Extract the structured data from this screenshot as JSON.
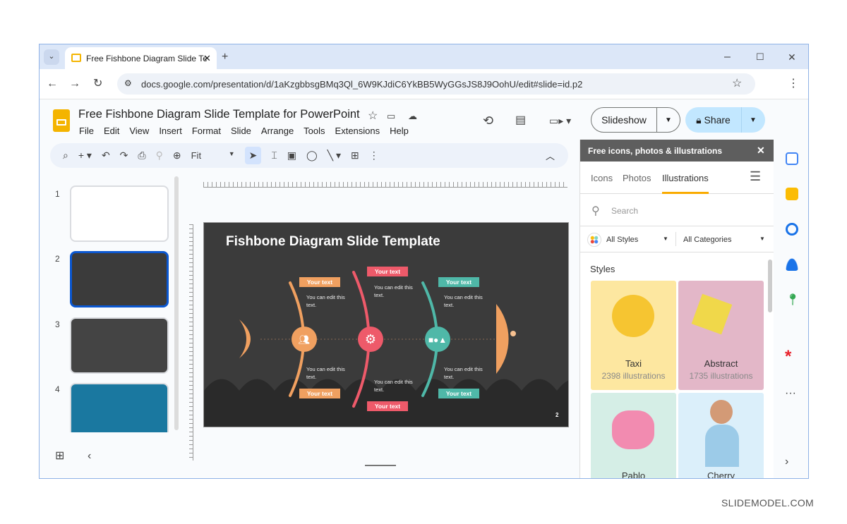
{
  "browser": {
    "tab_title": "Free Fishbone Diagram Slide Te",
    "url": "docs.google.com/presentation/d/1aKzgbbsgBMq3Ql_6W9KJdiC6YkBB5WyGGsJS8J9OohU/edit#slide=id.p2"
  },
  "doc": {
    "title": "Free Fishbone Diagram Slide Template for PowerPoint",
    "menu": [
      "File",
      "Edit",
      "View",
      "Insert",
      "Format",
      "Slide",
      "Arrange",
      "Tools",
      "Extensions",
      "Help"
    ],
    "slideshow": "Slideshow",
    "share": "Share"
  },
  "toolbar": {
    "zoom": "Fit"
  },
  "filmstrip": {
    "numbers": [
      "1",
      "2",
      "3",
      "4"
    ],
    "selected": 2
  },
  "slide": {
    "title": "Fishbone Diagram Slide Template",
    "label": "Your text",
    "body": "You can edit this text.",
    "page": "2",
    "colors": {
      "orange": "#f0a060",
      "red": "#ee5a6a",
      "teal": "#4fb8a8",
      "bg": "#3b3b3b"
    }
  },
  "panel": {
    "header": "Free icons, photos & illustrations",
    "tabs": [
      "Icons",
      "Photos",
      "Illustrations"
    ],
    "active_tab": "Illustrations",
    "search_placeholder": "Search",
    "styles_filter": "All Styles",
    "categories_filter": "All Categories",
    "section": "Styles",
    "cards": [
      {
        "name": "Taxi",
        "count": "2398 illustrations"
      },
      {
        "name": "Abstract",
        "count": "1735 illustrations"
      },
      {
        "name": "Pablo"
      },
      {
        "name": "Cherry"
      }
    ]
  },
  "watermark": "SLIDEMODEL.COM"
}
